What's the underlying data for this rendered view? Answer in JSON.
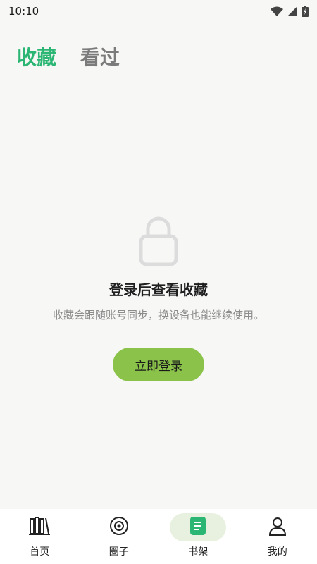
{
  "status_bar": {
    "time": "10:10"
  },
  "tabs": [
    {
      "label": "收藏",
      "active": true
    },
    {
      "label": "看过",
      "active": false
    }
  ],
  "empty_state": {
    "icon": "lock-icon",
    "title": "登录后查看收藏",
    "description": "收藏会跟随账号同步，换设备也能继续使用。",
    "button_label": "立即登录"
  },
  "bottom_nav": {
    "items": [
      {
        "label": "首页",
        "icon": "bookshelf-icon",
        "active": false
      },
      {
        "label": "圈子",
        "icon": "target-icon",
        "active": false
      },
      {
        "label": "书架",
        "icon": "book-icon",
        "active": true
      },
      {
        "label": "我的",
        "icon": "person-icon",
        "active": false
      }
    ]
  },
  "colors": {
    "accent": "#2bb673",
    "button": "#8bc34a",
    "nav_active_bg": "#e8f1df",
    "background": "#f7f7f5"
  }
}
